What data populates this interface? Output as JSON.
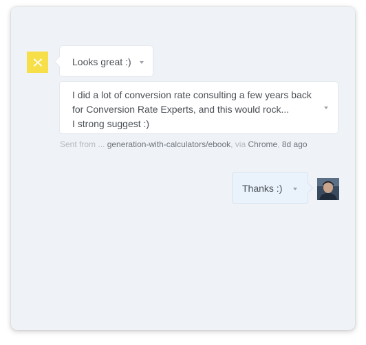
{
  "conversation": {
    "message_1": {
      "text": "Looks great :)"
    },
    "message_2": {
      "lines": [
        "I did a lot of conversion  rate consulting a few years back",
        "for Conversion Rate Experts, and this would rock...",
        "I strong suggest :)"
      ]
    },
    "meta": {
      "sent_from_label": "Sent from ...",
      "page": "generation-with-calculators/ebook",
      "via_label": ", via",
      "browser": "Chrome",
      "separator": ",",
      "time": "8d ago"
    },
    "reply": {
      "text": "Thanks :)"
    }
  },
  "icons": {
    "left_avatar": "app-logo-avatar",
    "right_avatar": "user-photo-avatar",
    "menu_caret": "caret-down-icon"
  },
  "colors": {
    "panel_bg": "#eff2f6",
    "logo_yellow": "#f7df4a",
    "reply_bg": "#eaf3fb"
  }
}
